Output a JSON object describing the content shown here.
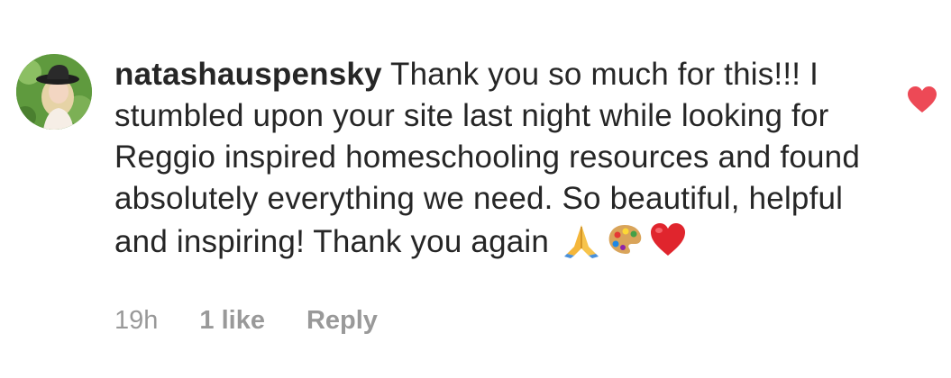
{
  "comment": {
    "username": "natashauspensky",
    "text": "Thank you so much for this!!! I stumbled upon your site last night while looking for Reggio inspired homeschooling resources and found absolutely everything we need. So beautiful, helpful and inspiring! Thank you again",
    "emojis": [
      "folded-hands-icon",
      "artist-palette-icon",
      "red-heart-icon"
    ],
    "time": "19h",
    "likes": "1 like",
    "reply_label": "Reply",
    "liked": true
  },
  "colors": {
    "text": "#262626",
    "meta": "#999999",
    "like_heart": "#ed4956"
  }
}
